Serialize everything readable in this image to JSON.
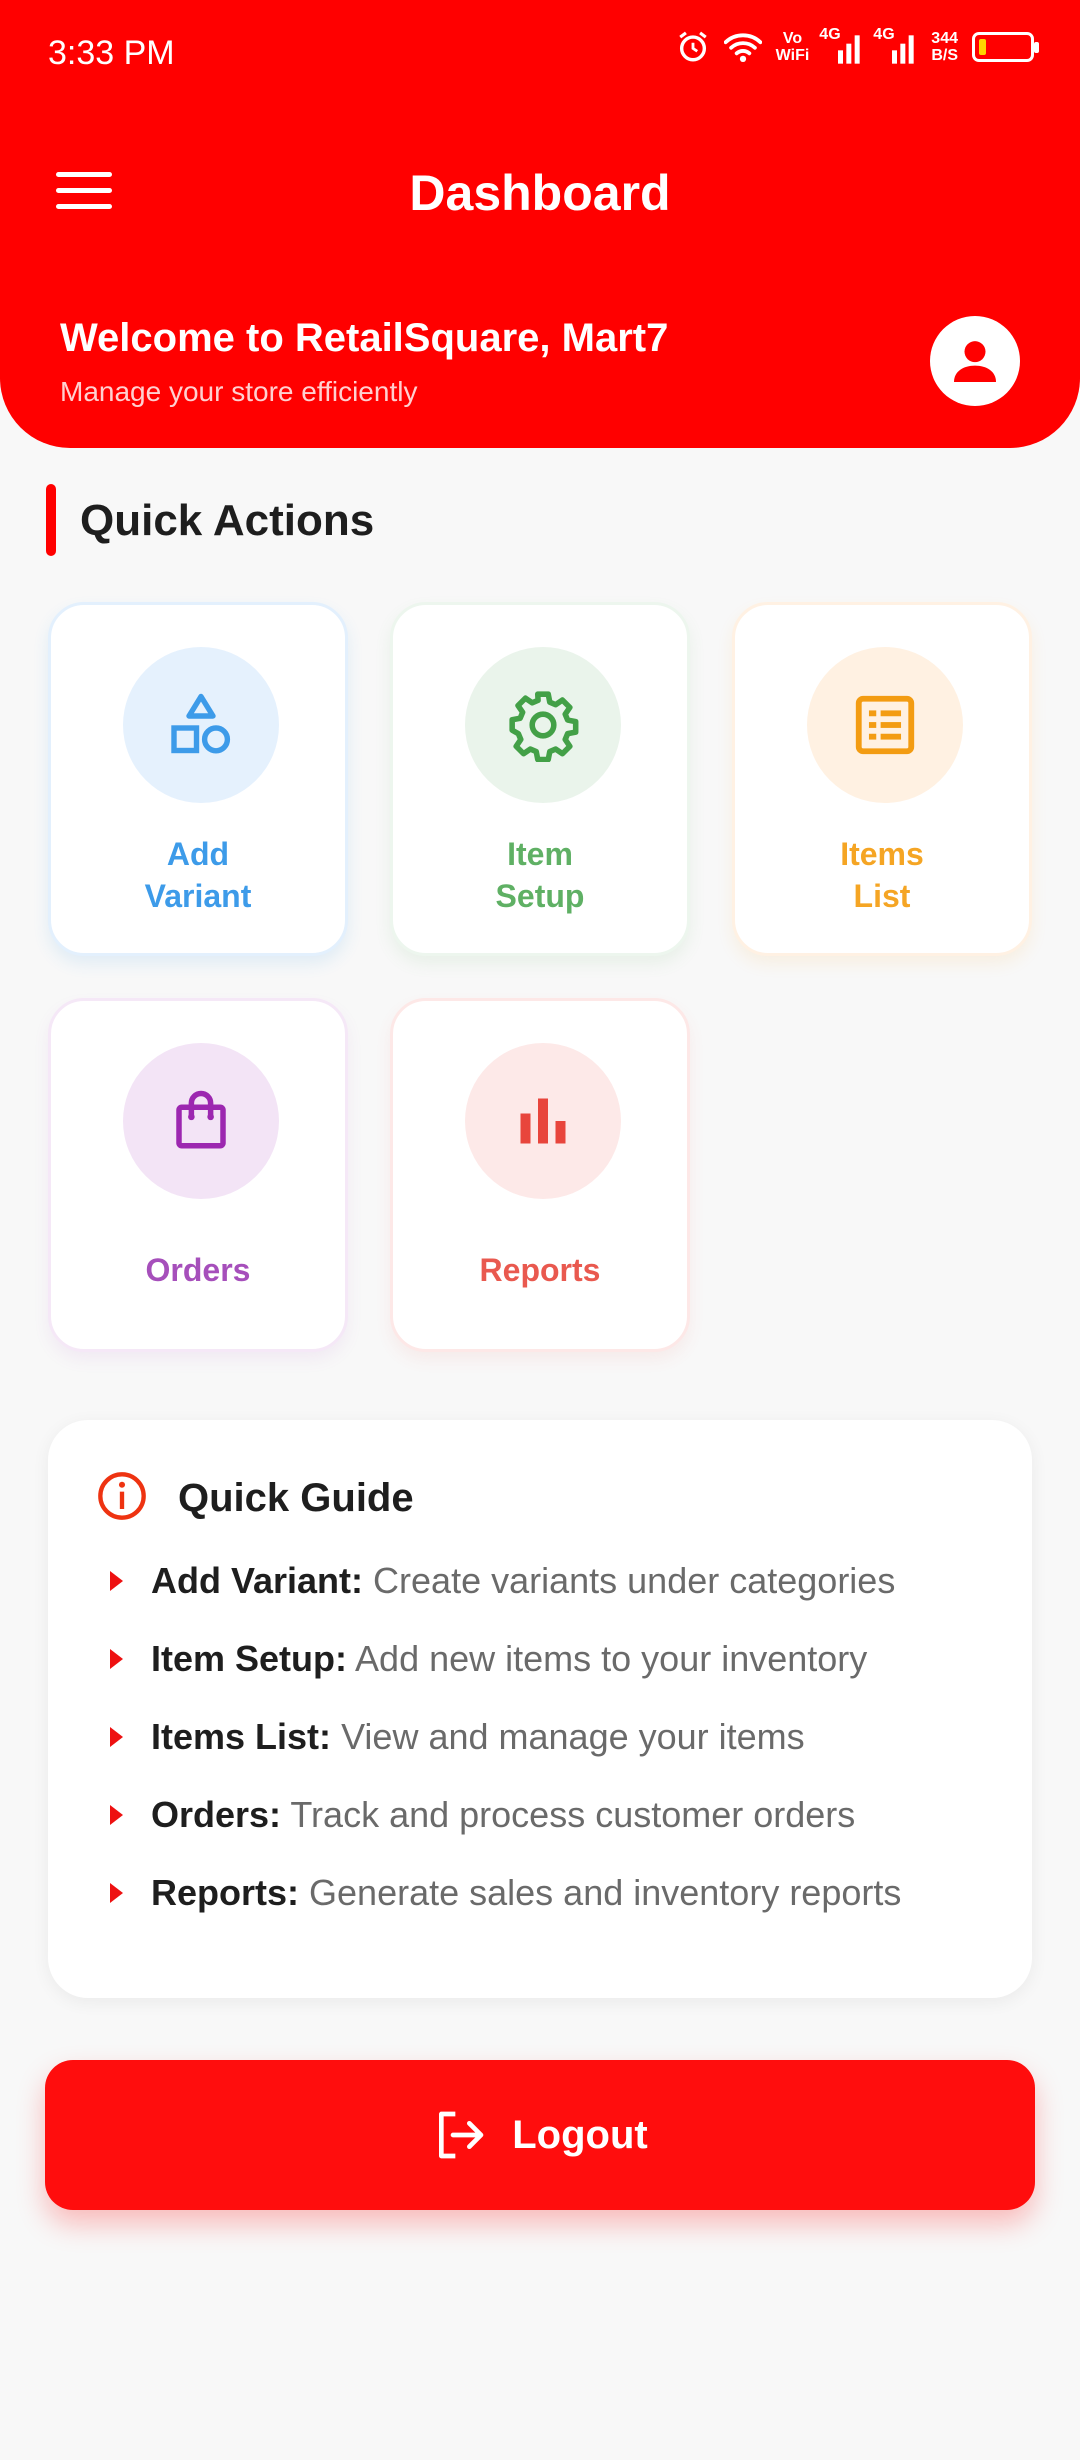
{
  "status_bar": {
    "time": "3:33 PM",
    "vowifi_top": "Vo",
    "vowifi_bottom": "WiFi",
    "net1": "4G",
    "net2": "4G",
    "speed_top": "344",
    "speed_bottom": "B/S",
    "battery_level": 0.15
  },
  "header": {
    "title": "Dashboard",
    "welcome": "Welcome to RetailSquare, Mart7",
    "subtitle": "Manage your store efficiently",
    "accent_color": "#ff0000"
  },
  "quick_actions": {
    "title": "Quick Actions",
    "items": [
      {
        "line1": "Add",
        "line2": "Variant",
        "color": "#3d9be9",
        "icon": "shapes-icon"
      },
      {
        "line1": "Item",
        "line2": "Setup",
        "color": "#5fb064",
        "icon": "gear-icon"
      },
      {
        "line1": "Items",
        "line2": "List",
        "color": "#f5a524",
        "icon": "list-icon"
      },
      {
        "line1": "Orders",
        "line2": "",
        "color": "#a64fbb",
        "icon": "shopping-bag-icon"
      },
      {
        "line1": "Reports",
        "line2": "",
        "color": "#e9594f",
        "icon": "bar-chart-icon"
      }
    ]
  },
  "guide": {
    "title": "Quick Guide",
    "items": [
      {
        "term": "Add Variant:",
        "desc": "Create variants under categories"
      },
      {
        "term": "Item Setup:",
        "desc": "Add new items to your inventory"
      },
      {
        "term": "Items List:",
        "desc": "View and manage your items"
      },
      {
        "term": "Orders:",
        "desc": "Track and process customer orders"
      },
      {
        "term": "Reports:",
        "desc": "Generate sales and inventory reports"
      }
    ]
  },
  "logout": {
    "label": "Logout"
  }
}
